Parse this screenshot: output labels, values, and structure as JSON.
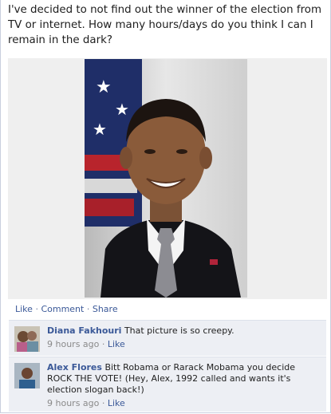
{
  "post": {
    "text": "I've decided to not find out the winner of the election from TV or internet. How many hours/days do you think I can I remain in the dark?"
  },
  "actions": {
    "like": "Like",
    "comment": "Comment",
    "share": "Share",
    "separator": "·"
  },
  "comments": [
    {
      "author": "Diana Fakhouri",
      "text": "That picture is so creepy.",
      "time": "9 hours ago",
      "like": "Like"
    },
    {
      "author": "Alex Flores",
      "text": "Bitt Robama or Rarack Mobama you decide ROCK THE VOTE! (Hey, Alex, 1992 called and wants it's election slogan back!)",
      "time": "9 hours ago",
      "like": "Like"
    }
  ],
  "colors": {
    "link": "#3b5998",
    "comment_bg": "#edeff4",
    "photo_bg": "#efefef"
  }
}
